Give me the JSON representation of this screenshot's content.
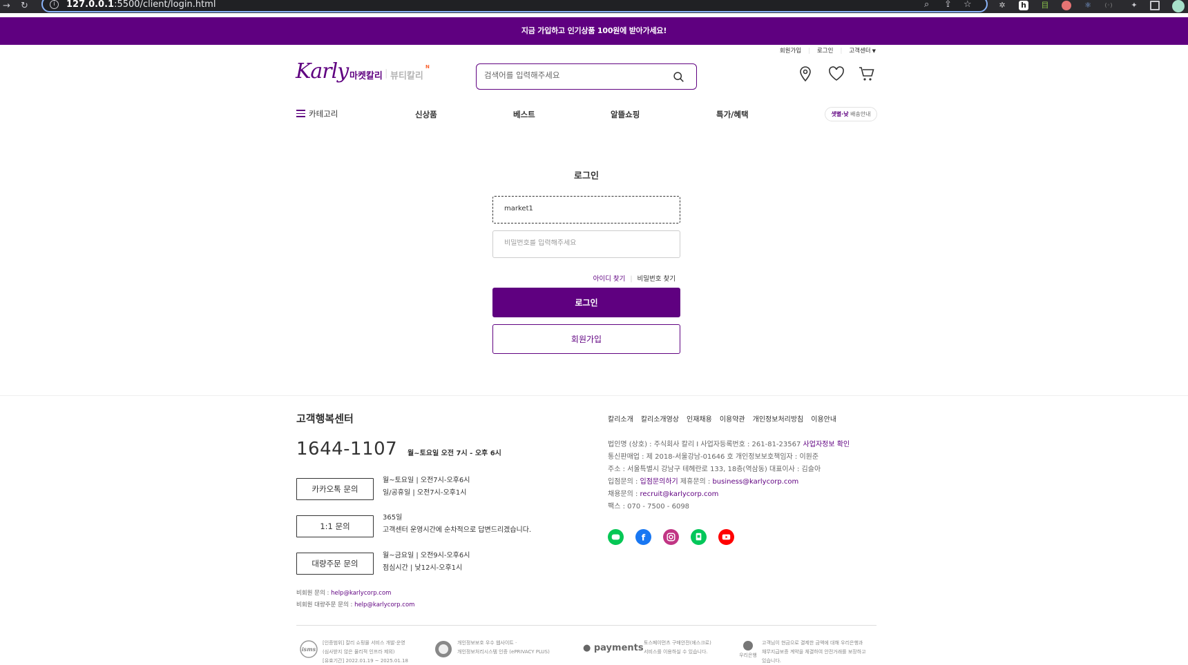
{
  "browser": {
    "url_host": "127.0.0.1",
    "url_path": ":5500/client/login.html"
  },
  "promo": {
    "text": "지금 가입하고 인기상품 100원에 받아가세요!"
  },
  "util_nav": {
    "signup": "회원가입",
    "login": "로그인",
    "customer_center": "고객센터"
  },
  "header": {
    "logo": "Karly",
    "tab_market": "마켓칼리",
    "tab_beauty": "뷰티칼리",
    "new_badge": "N",
    "search_placeholder": "검색어를 입력해주세요"
  },
  "gnb": {
    "category": "카테고리",
    "items": [
      "신상품",
      "베스트",
      "알뜰쇼핑",
      "특가/혜택"
    ],
    "delivery_prefix": "샛별·낮",
    "delivery_suffix": " 배송안내"
  },
  "login": {
    "title": "로그인",
    "id_value": "market1",
    "password_placeholder": "비밀번호를 입력해주세요",
    "find_id": "아이디 찾기",
    "find_pw": "비밀번호 찾기",
    "login_button": "로그인",
    "join_button": "회원가입"
  },
  "footer": {
    "cs_title": "고객행복센터",
    "cs_phone": "1644-1107",
    "cs_phone_note": "월~토요일 오전 7시 - 오후 6시",
    "cs_items": [
      {
        "button": "카카오톡 문의",
        "line1": "월~토요일 | 오전7시-오후6시",
        "line2": "일/공휴일 | 오전7시-오후1시"
      },
      {
        "button": "1:1 문의",
        "line1": "365일",
        "line2": "고객센터 운영시간에 순차적으로 답변드리겠습니다."
      },
      {
        "button": "대량주문 문의",
        "line1": "월~금요일 | 오전9시-오후6시",
        "line2": "점심시간 | 낮12시-오후1시"
      }
    ],
    "mail1_label": "비회원 문의 : ",
    "mail1": "help@karlycorp.com",
    "mail2_label": "비회원 대량주문 문의 : ",
    "mail2": "help@karlycorp.com",
    "links": [
      "칼리소개",
      "칼리소개영상",
      "인재채용",
      "이용약관",
      "개인정보처리방침",
      "이용안내"
    ],
    "info": {
      "line1": "법인명 (상호) : 주식회사 칼리 I  사업자등록번호 : 261-81-23567 ",
      "line1_link": "사업자정보 확인",
      "line2": "통신판매업 : 제 2018-서울강남-01646 호 개인정보보호책임자 : 이원준",
      "line3": "주소 : 서울특별시 강남구 테헤란로 133, 18층(역삼동) 대표이사 : 김슬아",
      "line4_a": "입점문의 : ",
      "line4_link1": "입점문의하기",
      "line4_b": " 제휴문의 : ",
      "line4_link2": "business@karlycorp.com",
      "line5_a": "채용문의 : ",
      "line5_link": "recruit@karlycorp.com",
      "line6": "팩스 : 070 - 7500 - 6098"
    },
    "certs": [
      {
        "l1": "[인증범위] 칼리 쇼핑몰 서비스 개발·운영",
        "l2": "(심사받지 않은 물리적 인프라 제외)",
        "l3": "[유효기간] 2022.01.19 ~ 2025.01.18"
      },
      {
        "l1": "개인정보보호 우수 웹사이트 ·",
        "l2": "개인정보처리시스템 인증 (ePRIVACY PLUS)",
        "l3": ""
      },
      {
        "l1": "토스페이먼츠 구매안전(에스크로)",
        "l2": "서비스를 이용하실 수 있습니다.",
        "l3": ""
      },
      {
        "l1": "고객님이 현금으로 결제한 금액에 대해 우리은행과",
        "l2": "채무지급보증 계약을 체결하여 안전거래를 보장하고",
        "l3": "있습니다."
      }
    ],
    "cert_logos": {
      "isms": "isms",
      "payments": "payments",
      "bank": "우리은행"
    }
  },
  "colors": {
    "brand": "#5f0080",
    "line": "#06c755",
    "facebook": "#1877f2",
    "instagram": "#c13584",
    "naver": "#03c75a",
    "youtube": "#ff0000"
  }
}
